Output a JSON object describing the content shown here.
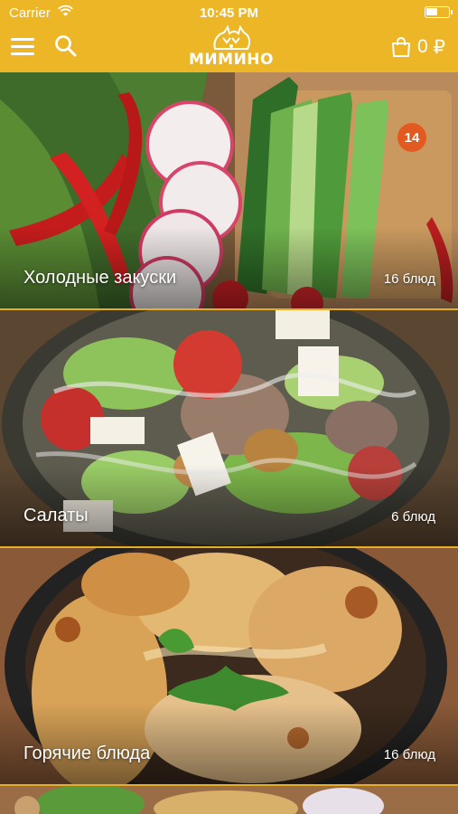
{
  "status_bar": {
    "carrier": "Carrier",
    "time": "10:45 PM"
  },
  "header": {
    "logo_text": "МИМИНО",
    "cart_count": "0",
    "currency": "₽",
    "icons": [
      "menu-icon",
      "search-icon",
      "cart-icon"
    ]
  },
  "categories": [
    {
      "title": "Холодные закуски",
      "count": "16 блюд",
      "badge": "14"
    },
    {
      "title": "Салаты",
      "count": "6 блюд"
    },
    {
      "title": "Горячие блюда",
      "count": "16 блюд"
    },
    {
      "title": ""
    }
  ],
  "colors": {
    "accent": "#ecb626",
    "badge": "#e25a20",
    "text_on_image": "#ffffff"
  }
}
